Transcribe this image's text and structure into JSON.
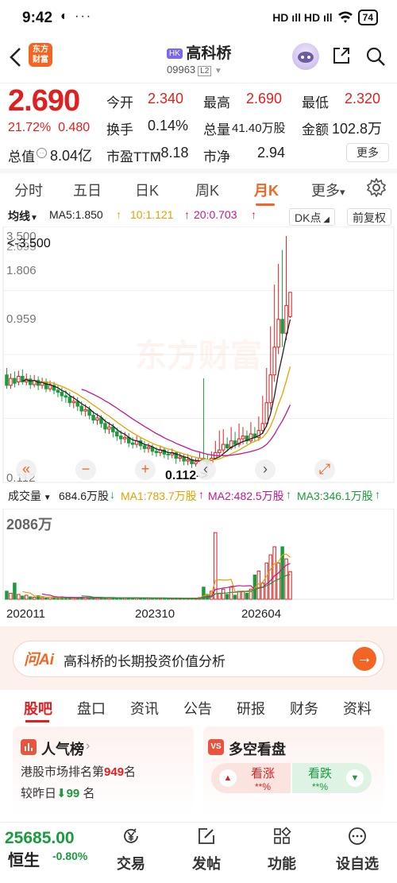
{
  "status_bar": {
    "time": "9:42",
    "left_icons": "◐ ···",
    "network": "HD ıll HD ıll",
    "battery": "74"
  },
  "header": {
    "logo_text_1": "东方",
    "logo_text_2": "财富",
    "market_badge": "HK",
    "stock_name": "高科桥",
    "stock_code": "09963",
    "level": "L2"
  },
  "quote": {
    "price": "2.690",
    "change_pct": "21.72%",
    "change_abs": "0.480",
    "open_label": "今开",
    "open": "2.340",
    "high_label": "最高",
    "high": "2.690",
    "low_label": "最低",
    "low": "2.320",
    "turnover_label": "换手",
    "turnover": "0.14%",
    "volume_label": "总量",
    "volume": "41.40万股",
    "amount_label": "金额",
    "amount": "102.8万",
    "mktcap_label": "总值",
    "mktcap": "8.04亿",
    "pe_label": "市盈TTM",
    "pe": "−8.18",
    "pb_label": "市净",
    "pb": "2.94",
    "more_label": "更多"
  },
  "ktabs": {
    "items": [
      "分时",
      "五日",
      "日K",
      "周K",
      "月K",
      "更多"
    ],
    "active": "月K",
    "more_suffix": "▾"
  },
  "ma_legend": {
    "type_label": "均线",
    "ma5": "MA5:1.850",
    "ma10": "10:1.121",
    "ma20": "20:0.703",
    "dk_label": "DK点",
    "adj_label": "前复权"
  },
  "colors": {
    "up": "#e02020",
    "down": "#1a9b3c",
    "ma5": "#222222",
    "ma10": "#e6a100",
    "ma20": "#c2188e",
    "accent": "#f26522"
  },
  "chart_labels": {
    "y_top": "3.500",
    "y_top_overlap": "2.695",
    "y_mid1": "1.806",
    "y_mid2": "0.959",
    "y_bottom": "0.112",
    "high_marker": "<-3.500",
    "low_marker": "0.112->",
    "watermark": "东方财富"
  },
  "chart_controls": [
    "«",
    "−",
    "+",
    "‹",
    "›",
    "⤢"
  ],
  "volume_legend": {
    "type_label": "成交量",
    "vol": "684.6万股",
    "ma1": "MA1:783.7万股",
    "ma2": "MA2:482.5万股",
    "ma3": "MA3:346.1万股",
    "y_max": "2086万"
  },
  "x_dates": [
    "202011",
    "202310",
    "202604"
  ],
  "chart_data": {
    "type": "candlestick",
    "period": "monthly",
    "ylim": [
      0.112,
      3.5
    ],
    "y_ticks": [
      "3.500",
      "1.806",
      "0.959",
      "0.112"
    ],
    "x_ticks": [
      "202011",
      "202310",
      "202604"
    ],
    "last": {
      "close": 2.69,
      "ma5": 1.85,
      "ma10": 1.121,
      "ma20": 0.703
    },
    "high": 3.5,
    "low": 0.112,
    "candles": [
      [
        1.5,
        1.35,
        1.6,
        1.3
      ],
      [
        1.35,
        1.45,
        1.52,
        1.3
      ],
      [
        1.45,
        1.38,
        1.55,
        1.32
      ],
      [
        1.4,
        1.48,
        1.56,
        1.35
      ],
      [
        1.48,
        1.4,
        1.58,
        1.36
      ],
      [
        1.4,
        1.44,
        1.52,
        1.35
      ],
      [
        1.44,
        1.36,
        1.5,
        1.3
      ],
      [
        1.36,
        1.42,
        1.5,
        1.32
      ],
      [
        1.42,
        1.35,
        1.48,
        1.28
      ],
      [
        1.35,
        1.4,
        1.46,
        1.3
      ],
      [
        1.4,
        1.3,
        1.45,
        1.25
      ],
      [
        1.3,
        1.35,
        1.42,
        1.26
      ],
      [
        1.35,
        1.28,
        1.4,
        1.22
      ],
      [
        1.28,
        1.25,
        1.36,
        1.18
      ],
      [
        1.25,
        1.2,
        1.32,
        1.12
      ],
      [
        1.2,
        1.18,
        1.28,
        1.1
      ],
      [
        1.18,
        1.1,
        1.25,
        1.04
      ],
      [
        1.1,
        1.12,
        1.2,
        1.02
      ],
      [
        1.12,
        1.05,
        1.18,
        0.98
      ],
      [
        1.05,
        0.98,
        1.12,
        0.92
      ],
      [
        0.98,
        1.0,
        1.08,
        0.9
      ],
      [
        1.0,
        0.92,
        1.05,
        0.86
      ],
      [
        0.92,
        0.85,
        0.98,
        0.8
      ],
      [
        0.85,
        0.88,
        0.95,
        0.78
      ],
      [
        0.88,
        0.8,
        0.92,
        0.74
      ],
      [
        0.8,
        0.72,
        0.86,
        0.66
      ],
      [
        0.72,
        0.75,
        0.82,
        0.65
      ],
      [
        0.75,
        0.68,
        0.8,
        0.6
      ],
      [
        0.68,
        0.62,
        0.74,
        0.55
      ],
      [
        0.62,
        0.58,
        0.7,
        0.5
      ],
      [
        0.58,
        0.6,
        0.68,
        0.52
      ],
      [
        0.6,
        0.52,
        0.66,
        0.46
      ],
      [
        0.52,
        0.5,
        0.6,
        0.44
      ],
      [
        0.5,
        0.55,
        0.62,
        0.45
      ],
      [
        0.55,
        0.48,
        0.6,
        0.42
      ],
      [
        0.48,
        0.44,
        0.55,
        0.38
      ],
      [
        0.44,
        0.46,
        0.52,
        0.38
      ],
      [
        0.46,
        0.4,
        0.5,
        0.34
      ],
      [
        0.4,
        0.38,
        0.46,
        0.32
      ],
      [
        0.38,
        0.42,
        0.48,
        0.33
      ],
      [
        0.42,
        0.36,
        0.46,
        0.3
      ],
      [
        0.36,
        0.35,
        0.42,
        0.28
      ],
      [
        0.35,
        0.38,
        0.44,
        0.3
      ],
      [
        0.38,
        0.3,
        0.4,
        0.22
      ],
      [
        0.3,
        0.32,
        0.38,
        0.25
      ],
      [
        0.32,
        0.26,
        0.36,
        0.2
      ],
      [
        0.26,
        0.28,
        0.36,
        0.2
      ],
      [
        0.28,
        0.22,
        0.32,
        0.16
      ],
      [
        0.22,
        0.25,
        0.3,
        0.18
      ],
      [
        0.25,
        0.3,
        0.38,
        0.22
      ],
      [
        0.3,
        0.28,
        1.45,
        0.25
      ],
      [
        0.28,
        0.22,
        0.35,
        0.112
      ],
      [
        0.22,
        0.3,
        0.4,
        0.2
      ],
      [
        0.3,
        0.38,
        0.55,
        0.28
      ],
      [
        0.38,
        0.42,
        0.7,
        0.34
      ],
      [
        0.42,
        0.5,
        0.72,
        0.38
      ],
      [
        0.5,
        0.45,
        0.6,
        0.4
      ],
      [
        0.45,
        0.55,
        0.75,
        0.42
      ],
      [
        0.55,
        0.5,
        0.68,
        0.44
      ],
      [
        0.5,
        0.58,
        0.8,
        0.46
      ],
      [
        0.58,
        0.62,
        0.75,
        0.5
      ],
      [
        0.62,
        0.55,
        0.7,
        0.5
      ],
      [
        0.55,
        0.65,
        0.82,
        0.52
      ],
      [
        0.65,
        0.6,
        0.75,
        0.55
      ],
      [
        0.6,
        0.7,
        0.9,
        0.55
      ],
      [
        0.7,
        0.8,
        1.2,
        0.65
      ],
      [
        0.8,
        1.1,
        1.6,
        0.75
      ],
      [
        1.1,
        1.5,
        2.2,
        1.0
      ],
      [
        1.5,
        1.9,
        2.8,
        1.4
      ],
      [
        1.9,
        2.3,
        3.1,
        1.8
      ],
      [
        2.3,
        2.1,
        3.3,
        1.9
      ],
      [
        2.1,
        2.5,
        3.5,
        2.0
      ],
      [
        2.34,
        2.69,
        2.69,
        2.32
      ]
    ],
    "ma_lines": {
      "MA5": "black",
      "MA10": "orange",
      "MA20": "magenta"
    },
    "volume_max": "2086万",
    "volume": [
      200,
      150,
      400,
      120,
      80,
      100,
      60,
      50,
      90,
      40,
      30,
      50,
      40,
      30,
      60,
      40,
      35,
      30,
      45,
      50,
      40,
      30,
      35,
      30,
      40,
      35,
      30,
      40,
      30,
      25,
      30,
      35,
      40,
      30,
      25,
      30,
      28,
      25,
      30,
      25,
      20,
      25,
      30,
      25,
      20,
      25,
      30,
      30,
      25,
      40,
      300,
      120,
      200,
      1650,
      150,
      250,
      120,
      300,
      100,
      200,
      200,
      150,
      250,
      600,
      700,
      400,
      900,
      1100,
      1300,
      900,
      1300,
      1000,
      684.6
    ]
  },
  "ai": {
    "logo": "问Ai",
    "text": "高科桥的长期投资价值分析",
    "go": "→"
  },
  "section_tabs": {
    "items": [
      "股吧",
      "盘口",
      "资讯",
      "公告",
      "研报",
      "财务",
      "资料"
    ],
    "active": "股吧"
  },
  "popularity": {
    "title": "人气榜",
    "rank_prefix": "港股市场排名第",
    "rank": "949",
    "rank_suffix": "名",
    "change_prefix": "较昨日",
    "change": "99",
    "change_suffix": "名"
  },
  "sentiment": {
    "badge": "VS",
    "title": "多空看盘",
    "bull_label": "看涨",
    "bull_pct": "**%",
    "bear_label": "看跌",
    "bear_pct": "**%"
  },
  "index": {
    "value": "25685.00",
    "name": "恒生",
    "change": "-0.80%"
  },
  "bottom_nav": [
    {
      "label": "交易",
      "icon": "yen-circle-icon"
    },
    {
      "label": "发帖",
      "icon": "edit-icon"
    },
    {
      "label": "功能",
      "icon": "grid-icon"
    },
    {
      "label": "设自选",
      "icon": "more-circle-icon"
    }
  ]
}
